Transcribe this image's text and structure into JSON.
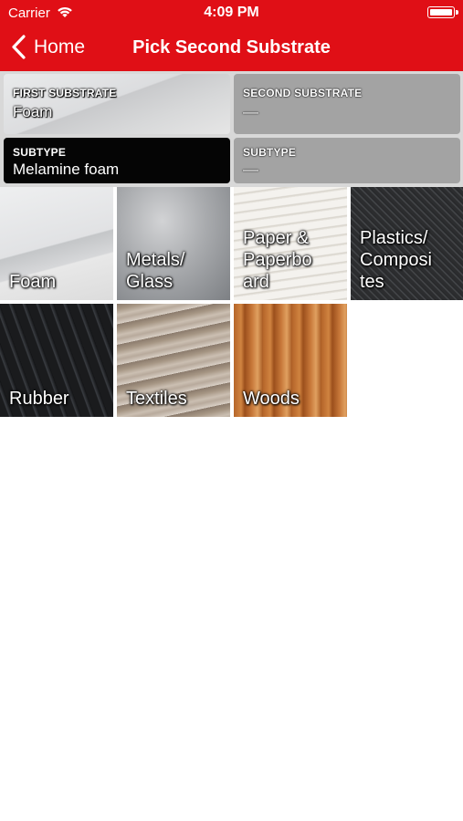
{
  "status_bar": {
    "carrier": "Carrier",
    "time": "4:09 PM"
  },
  "nav": {
    "back_label": "Home",
    "title": "Pick Second Substrate"
  },
  "selection": {
    "first_substrate": {
      "label": "FIRST SUBSTRATE",
      "value": "Foam"
    },
    "second_substrate": {
      "label": "SECOND SUBSTRATE",
      "value": "—"
    },
    "first_subtype": {
      "label": "SUBTYPE",
      "value": "Melamine foam"
    },
    "second_subtype": {
      "label": "SUBTYPE",
      "value": "—"
    }
  },
  "substrates": [
    {
      "name": "Foam"
    },
    {
      "name": "Metals/\nGlass"
    },
    {
      "name": "Paper &\nPaperbo\nard"
    },
    {
      "name": "Plastics/\nComposi\ntes"
    },
    {
      "name": "Rubber"
    },
    {
      "name": "Textiles"
    },
    {
      "name": "Woods"
    }
  ],
  "colors": {
    "brand_red": "#e00f16",
    "selected_card": "#050505",
    "empty_card": "#a3a3a3"
  },
  "icons": {
    "back": "chevron-left-icon",
    "wifi": "wifi-icon",
    "battery": "battery-icon"
  }
}
